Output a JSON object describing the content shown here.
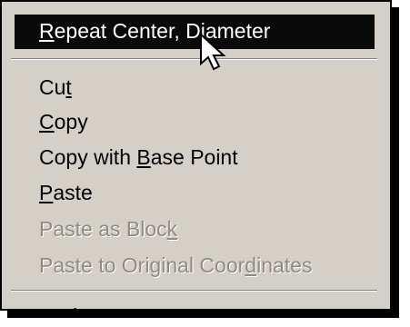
{
  "menu": {
    "selected": {
      "pre": "",
      "mnemonic": "R",
      "post": "epeat Center, Diameter"
    },
    "cut": {
      "pre": "Cu",
      "mnemonic": "t",
      "post": ""
    },
    "copy": {
      "pre": "",
      "mnemonic": "C",
      "post": "opy"
    },
    "copy_base": {
      "pre": "Copy with ",
      "mnemonic": "B",
      "post": "ase Point"
    },
    "paste": {
      "pre": "",
      "mnemonic": "P",
      "post": "aste"
    },
    "paste_block": {
      "pre": "Paste as Bloc",
      "mnemonic": "k",
      "post": ""
    },
    "paste_orig": {
      "pre": "Paste to Original Coor",
      "mnemonic": "d",
      "post": "inates"
    },
    "undo": {
      "pre": "",
      "mnemonic": "U",
      "post": "ndo"
    }
  },
  "colors": {
    "menu_bg": "#d4d0c8",
    "highlight_bg": "#0a0a0a",
    "disabled_text": "#8e8a84"
  },
  "icons": {
    "cursor": "arrow-cursor-icon"
  }
}
